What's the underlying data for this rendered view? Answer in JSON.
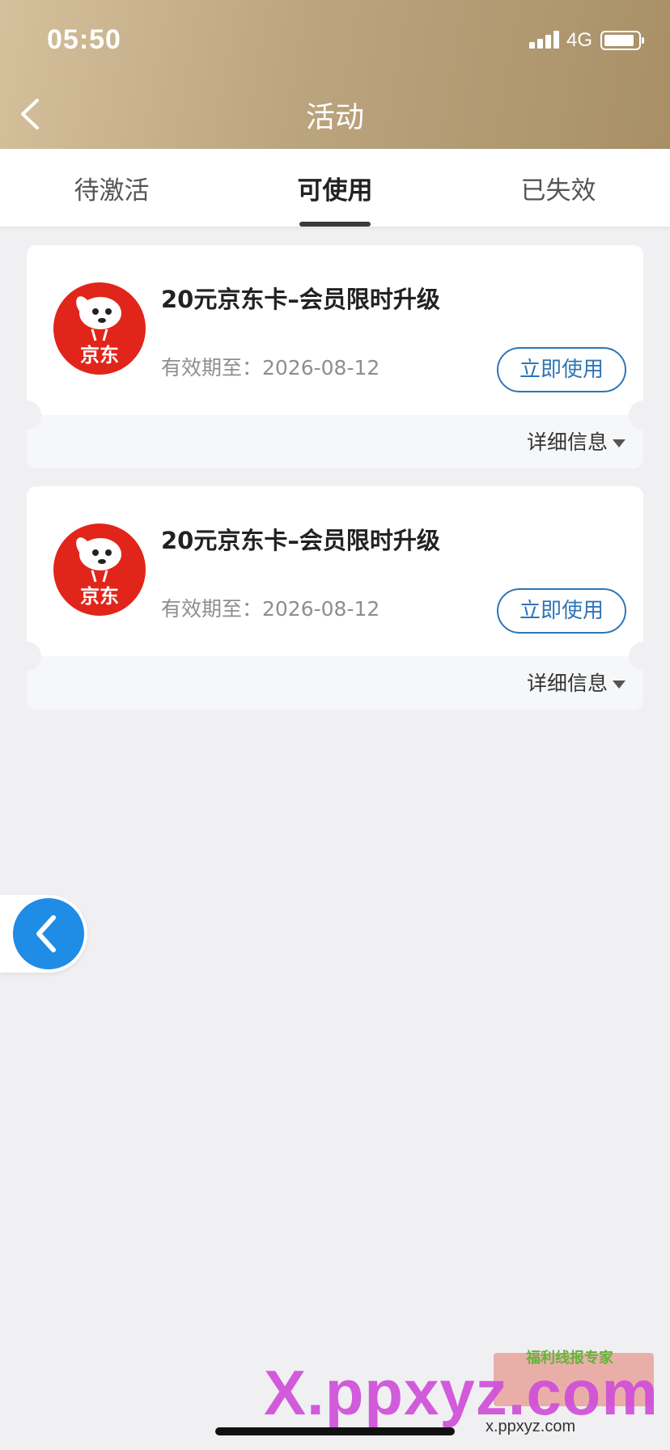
{
  "status_bar": {
    "time": "05:50",
    "network": "4G"
  },
  "header": {
    "title": "活动"
  },
  "tabs": [
    {
      "label": "待激活",
      "active": false
    },
    {
      "label": "可使用",
      "active": true
    },
    {
      "label": "已失效",
      "active": false
    }
  ],
  "coupons": [
    {
      "logo_text": "京东",
      "title": "20元京东卡–会员限时升级",
      "expiry": "有效期至：2026-08-12",
      "action_label": "立即使用",
      "detail_label": "详细信息"
    },
    {
      "logo_text": "京东",
      "title": "20元京东卡–会员限时升级",
      "expiry": "有效期至：2026-08-12",
      "action_label": "立即使用",
      "detail_label": "详细信息"
    }
  ],
  "watermark": {
    "main": "X.ppxyz.com",
    "sub": "x.ppxyz.com",
    "badge": "福利线报专家"
  },
  "colors": {
    "header_gradient_start": "#d5c09c",
    "header_gradient_end": "#a88f66",
    "accent_blue": "#2f75b5",
    "jd_red": "#e1251b",
    "float_button_blue": "#1f8ce6"
  },
  "icons": {
    "back": "chevron-left-icon",
    "detail_toggle": "caret-down-icon",
    "float_back": "chevron-left-icon"
  }
}
